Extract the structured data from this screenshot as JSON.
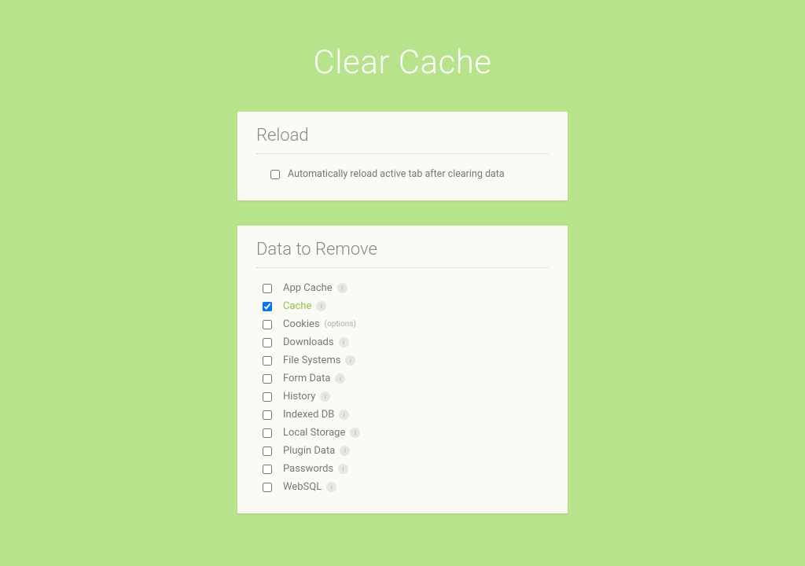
{
  "header": {
    "title": "Clear Cache"
  },
  "reload": {
    "title": "Reload",
    "auto_reload_label": "Automatically reload active tab after clearing data",
    "auto_reload_checked": false
  },
  "data_section": {
    "title": "Data to Remove",
    "options_link_label": "(options)",
    "items": [
      {
        "label": "App Cache",
        "checked": false,
        "has_info": true,
        "has_options_link": false
      },
      {
        "label": "Cache",
        "checked": true,
        "has_info": true,
        "has_options_link": false
      },
      {
        "label": "Cookies",
        "checked": false,
        "has_info": false,
        "has_options_link": true
      },
      {
        "label": "Downloads",
        "checked": false,
        "has_info": true,
        "has_options_link": false
      },
      {
        "label": "File Systems",
        "checked": false,
        "has_info": true,
        "has_options_link": false
      },
      {
        "label": "Form Data",
        "checked": false,
        "has_info": true,
        "has_options_link": false
      },
      {
        "label": "History",
        "checked": false,
        "has_info": true,
        "has_options_link": false
      },
      {
        "label": "Indexed DB",
        "checked": false,
        "has_info": true,
        "has_options_link": false
      },
      {
        "label": "Local Storage",
        "checked": false,
        "has_info": true,
        "has_options_link": false
      },
      {
        "label": "Plugin Data",
        "checked": false,
        "has_info": true,
        "has_options_link": false
      },
      {
        "label": "Passwords",
        "checked": false,
        "has_info": true,
        "has_options_link": false
      },
      {
        "label": "WebSQL",
        "checked": false,
        "has_info": true,
        "has_options_link": false
      }
    ]
  }
}
